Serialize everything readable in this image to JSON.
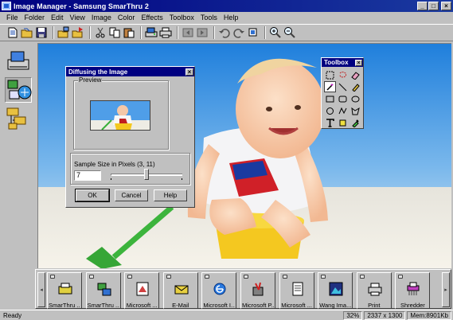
{
  "window": {
    "title": "Image Manager - Samsung SmarThru 2",
    "minimize": "_",
    "maximize": "□",
    "close": "×"
  },
  "menu": [
    "File",
    "Folder",
    "Edit",
    "View",
    "Image",
    "Color",
    "Effects",
    "Toolbox",
    "Tools",
    "Help"
  ],
  "toolbar_icons": [
    "new-icon",
    "open-icon",
    "save-icon",
    "copy-folder-icon",
    "move-folder-icon",
    "cut-icon",
    "copy-icon",
    "paste-icon",
    "scan-icon",
    "print-icon",
    "back-icon",
    "forward-icon",
    "undo-icon",
    "redo-icon",
    "crop-icon",
    "zoom-in-icon",
    "zoom-out-icon"
  ],
  "left_panel": [
    "scanner-icon",
    "image-browser-icon",
    "folder-tree-icon"
  ],
  "toolbox": {
    "title": "Toolbox",
    "close": "×",
    "tools": [
      "rect-select-icon",
      "lasso-icon",
      "eraser-icon",
      "magic-wand-icon",
      "line-icon",
      "pencil-icon",
      "rectangle-icon",
      "rounded-rect-icon",
      "ellipse-icon",
      "circle-icon",
      "polyline-icon",
      "polygon-icon",
      "text-icon",
      "fill-icon",
      "dropper-icon"
    ]
  },
  "dialog": {
    "title": "Diffusing the Image",
    "close": "×",
    "preview_label": "Preview",
    "sample_label": "Sample Size in Pixels (3, 11)",
    "sample_value": "7",
    "slider": {
      "min": 3,
      "max": 11,
      "value": 7
    },
    "ok": "OK",
    "cancel": "Cancel",
    "help": "Help"
  },
  "apps": [
    {
      "label": "SmarThru ...",
      "icon": "fax-icon"
    },
    {
      "label": "SmarThru ...",
      "icon": "network-icon"
    },
    {
      "label": "Microsoft ...",
      "icon": "ms-app-icon"
    },
    {
      "label": "E-Mail",
      "icon": "email-icon"
    },
    {
      "label": "Microsoft I...",
      "icon": "internet-explorer-icon"
    },
    {
      "label": "Microsoft P...",
      "icon": "paint-icon"
    },
    {
      "label": "Microsoft ...",
      "icon": "notepad-icon"
    },
    {
      "label": "Wang Ima...",
      "icon": "imaging-icon"
    },
    {
      "label": "Print",
      "icon": "printer-icon"
    },
    {
      "label": "Shredder",
      "icon": "shredder-icon"
    }
  ],
  "status": {
    "ready": "Ready",
    "zoom": "32%",
    "dimensions": "2337 x 1300",
    "memory": "Mem:8901Kb"
  }
}
